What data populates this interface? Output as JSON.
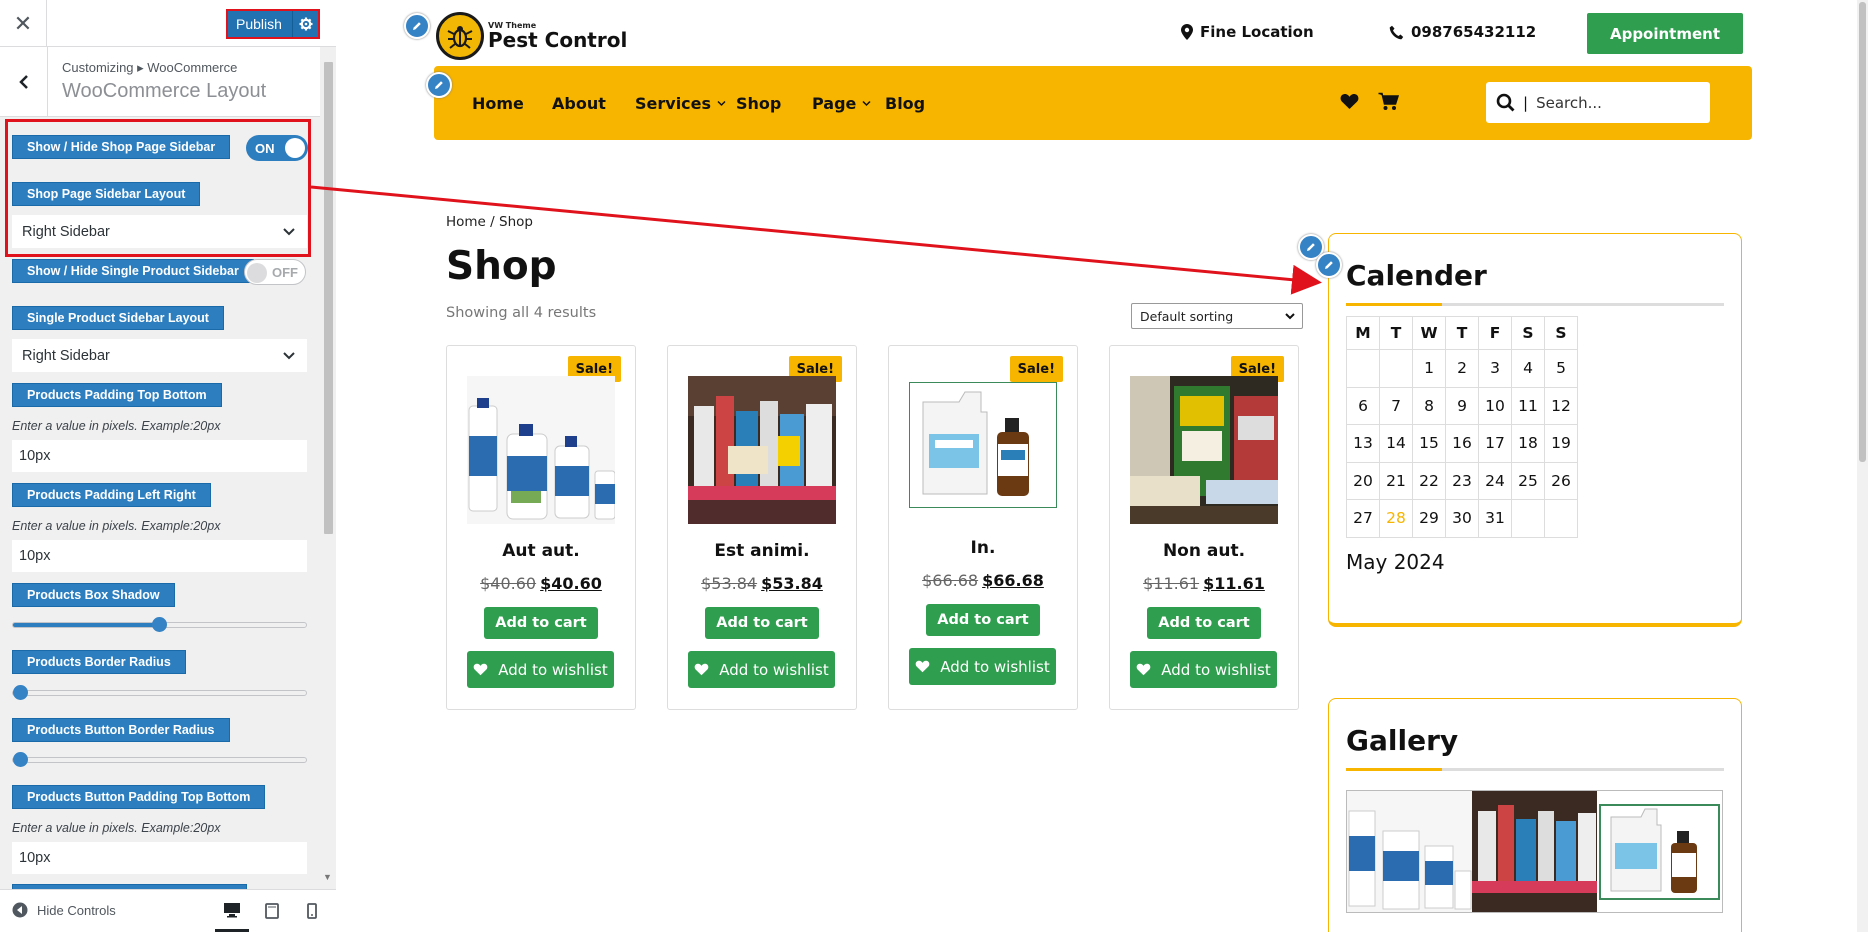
{
  "customizer": {
    "close_icon": "close-icon",
    "publish_label": "Publish",
    "breadcrumb": "Customizing ▸ WooCommerce",
    "section_title": "WooCommerce Layout",
    "controls": {
      "shop_sidebar_toggle_label": "Show / Hide Shop Page Sidebar",
      "shop_sidebar_toggle_state": "ON",
      "shop_sidebar_layout_label": "Shop Page Sidebar Layout",
      "shop_sidebar_layout_value": "Right Sidebar",
      "single_sidebar_toggle_label": "Show / Hide Single Product Sidebar",
      "single_sidebar_toggle_state": "OFF",
      "single_sidebar_layout_label": "Single Product Sidebar Layout",
      "single_sidebar_layout_value": "Right Sidebar",
      "padding_tb_label": "Products Padding Top Bottom",
      "padding_tb_hint": "Enter a value in pixels. Example:20px",
      "padding_tb_value": "10px",
      "padding_lr_label": "Products Padding Left Right",
      "padding_lr_hint": "Enter a value in pixels. Example:20px",
      "padding_lr_value": "10px",
      "box_shadow_label": "Products Box Shadow",
      "box_shadow_fraction": 0.5,
      "border_radius_label": "Products Border Radius",
      "border_radius_fraction": 0,
      "button_radius_label": "Products Button Border Radius",
      "button_radius_fraction": 0,
      "button_padding_label": "Products Button Padding Top Bottom",
      "button_padding_hint": "Enter a value in pixels. Example:20px",
      "button_padding_value": "10px"
    },
    "footer": {
      "hide_controls_label": "Hide Controls"
    },
    "colors": {
      "accent": "#2c7ebf",
      "highlight": "#e0121b"
    }
  },
  "site": {
    "logo_small": "VW Theme",
    "logo_big": "Pest Control",
    "location": "Fine Location",
    "phone": "098765432112",
    "appointment_label": "Appointment",
    "nav": [
      {
        "label": "Home"
      },
      {
        "label": "About"
      },
      {
        "label": "Services",
        "dropdown": true
      },
      {
        "label": "Shop"
      },
      {
        "label": "Page",
        "dropdown": true
      },
      {
        "label": "Blog"
      }
    ],
    "search_placeholder": "Search...",
    "colors": {
      "brand_yellow": "#f7b500",
      "button_green": "#2f9e4e"
    }
  },
  "shop": {
    "breadcrumb": "Home / Shop",
    "title": "Shop",
    "result_count": "Showing all 4 results",
    "sorting": "Default sorting",
    "sale_badge": "Sale!",
    "add_to_cart": "Add to cart",
    "add_to_wishlist": "Add to wishlist",
    "products": [
      {
        "name": "Aut aut.",
        "old_price": "$40.60",
        "price": "$40.60"
      },
      {
        "name": "Est animi.",
        "old_price": "$53.84",
        "price": "$53.84"
      },
      {
        "name": "In.",
        "old_price": "$66.68",
        "price": "$66.68"
      },
      {
        "name": "Non aut.",
        "old_price": "$11.61",
        "price": "$11.61"
      }
    ]
  },
  "sidebar": {
    "calendar_title": "Calender",
    "weekdays": [
      "M",
      "T",
      "W",
      "T",
      "F",
      "S",
      "S"
    ],
    "weeks": [
      [
        "",
        "",
        "1",
        "2",
        "3",
        "4",
        "5"
      ],
      [
        "6",
        "7",
        "8",
        "9",
        "10",
        "11",
        "12"
      ],
      [
        "13",
        "14",
        "15",
        "16",
        "17",
        "18",
        "19"
      ],
      [
        "20",
        "21",
        "22",
        "23",
        "24",
        "25",
        "26"
      ],
      [
        "27",
        "28",
        "29",
        "30",
        "31",
        "",
        ""
      ]
    ],
    "today": "28",
    "month": "May 2024",
    "gallery_title": "Gallery"
  }
}
